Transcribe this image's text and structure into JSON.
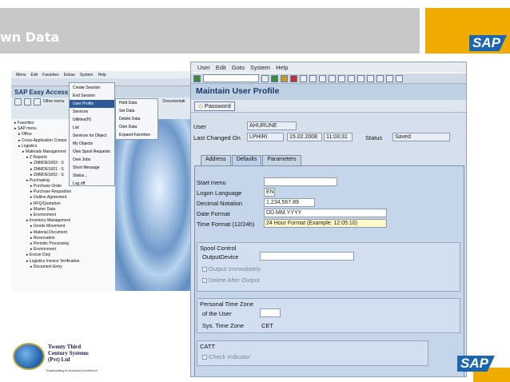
{
  "slide": {
    "title": "wn Data",
    "sap_logo": "SAP"
  },
  "easy_access": {
    "menu": [
      "Menu",
      "Edit",
      "Favorites",
      "Extras",
      "System",
      "Help"
    ],
    "title": "SAP Easy Access",
    "toolbar_other_menu": "Other menu",
    "tree": [
      "Favorites",
      "SAP menu",
      "Office",
      "Cross-Application Compo",
      "Logistics",
      "Materials Management",
      "Z Reports",
      "ZMMDES003 - S",
      "ZMMDES001 - S",
      "ZMMDES002 - S",
      "Purchasing",
      "Purchase Order",
      "Purchase Requisition",
      "Outline Agreement",
      "RFQ/Quotation",
      "Master Data",
      "Environment",
      "Inventory Management",
      "Goods Movement",
      "Material Document",
      "Reservation",
      "Periodic Processing",
      "Environment",
      "Excise Duty",
      "Logistics Invoice Verification",
      "Document Entry"
    ],
    "system_menu": [
      "Create Session",
      "End Session",
      "User Profile",
      "Services",
      "Utilities(H)",
      "List",
      "Services for Object",
      "My Objects",
      "Own Spool Requests",
      "Own Jobs",
      "Short Message",
      "Status...",
      "Log off"
    ],
    "user_profile_sub": [
      "Hold Data",
      "Set Data",
      "Delete Data",
      "Own Data",
      "Expand Favorites"
    ],
    "documentation_btn": "Documentati"
  },
  "window": {
    "menu": [
      "User",
      "Edit",
      "Goto",
      "System",
      "Help"
    ],
    "title": "Maintain User Profile",
    "password_button": "Password",
    "user_label": "User",
    "user_value": "AHURUNE",
    "last_changed_label": "Last Changed On",
    "last_changed_by": "LPHIRI",
    "last_changed_date": "15.02.2008",
    "last_changed_time": "11:03:31",
    "status_label": "Status",
    "status_value": "Saved",
    "tabs": [
      "Address",
      "Defaults",
      "Parameters"
    ],
    "active_tab": "Defaults",
    "start_menu_label": "Start menu",
    "start_menu_value": "",
    "logon_language_label": "Logon Language",
    "logon_language_value": "EN",
    "decimal_notation_label": "Decimal Notation",
    "decimal_notation_value": "1,234,567.89",
    "date_format_label": "Date Format",
    "date_format_value": "DD.MM.YYYY",
    "time_format_label": "Time Format (12/24h)",
    "time_format_value": "24 Hour Format (Example: 12:05:10)",
    "spool_title": "Spool Control",
    "output_device_label": "OutputDevice",
    "output_device_value": "",
    "output_immediately": "Output Immediately",
    "delete_after_output": "Delete After Output",
    "tz_title": "Personal Time Zone",
    "of_user_label": "of the User",
    "of_user_value": "",
    "sys_tz_label": "Sys. Time Zone",
    "sys_tz_value": "CET",
    "catt_title": "CATT",
    "check_indicator": "Check Indicator"
  },
  "company": {
    "name_line1": "Twenty Third",
    "name_line2": "Century Systems",
    "name_line3": "(Pvt) Ltd",
    "tagline": "Keyboarding to business excellence"
  }
}
